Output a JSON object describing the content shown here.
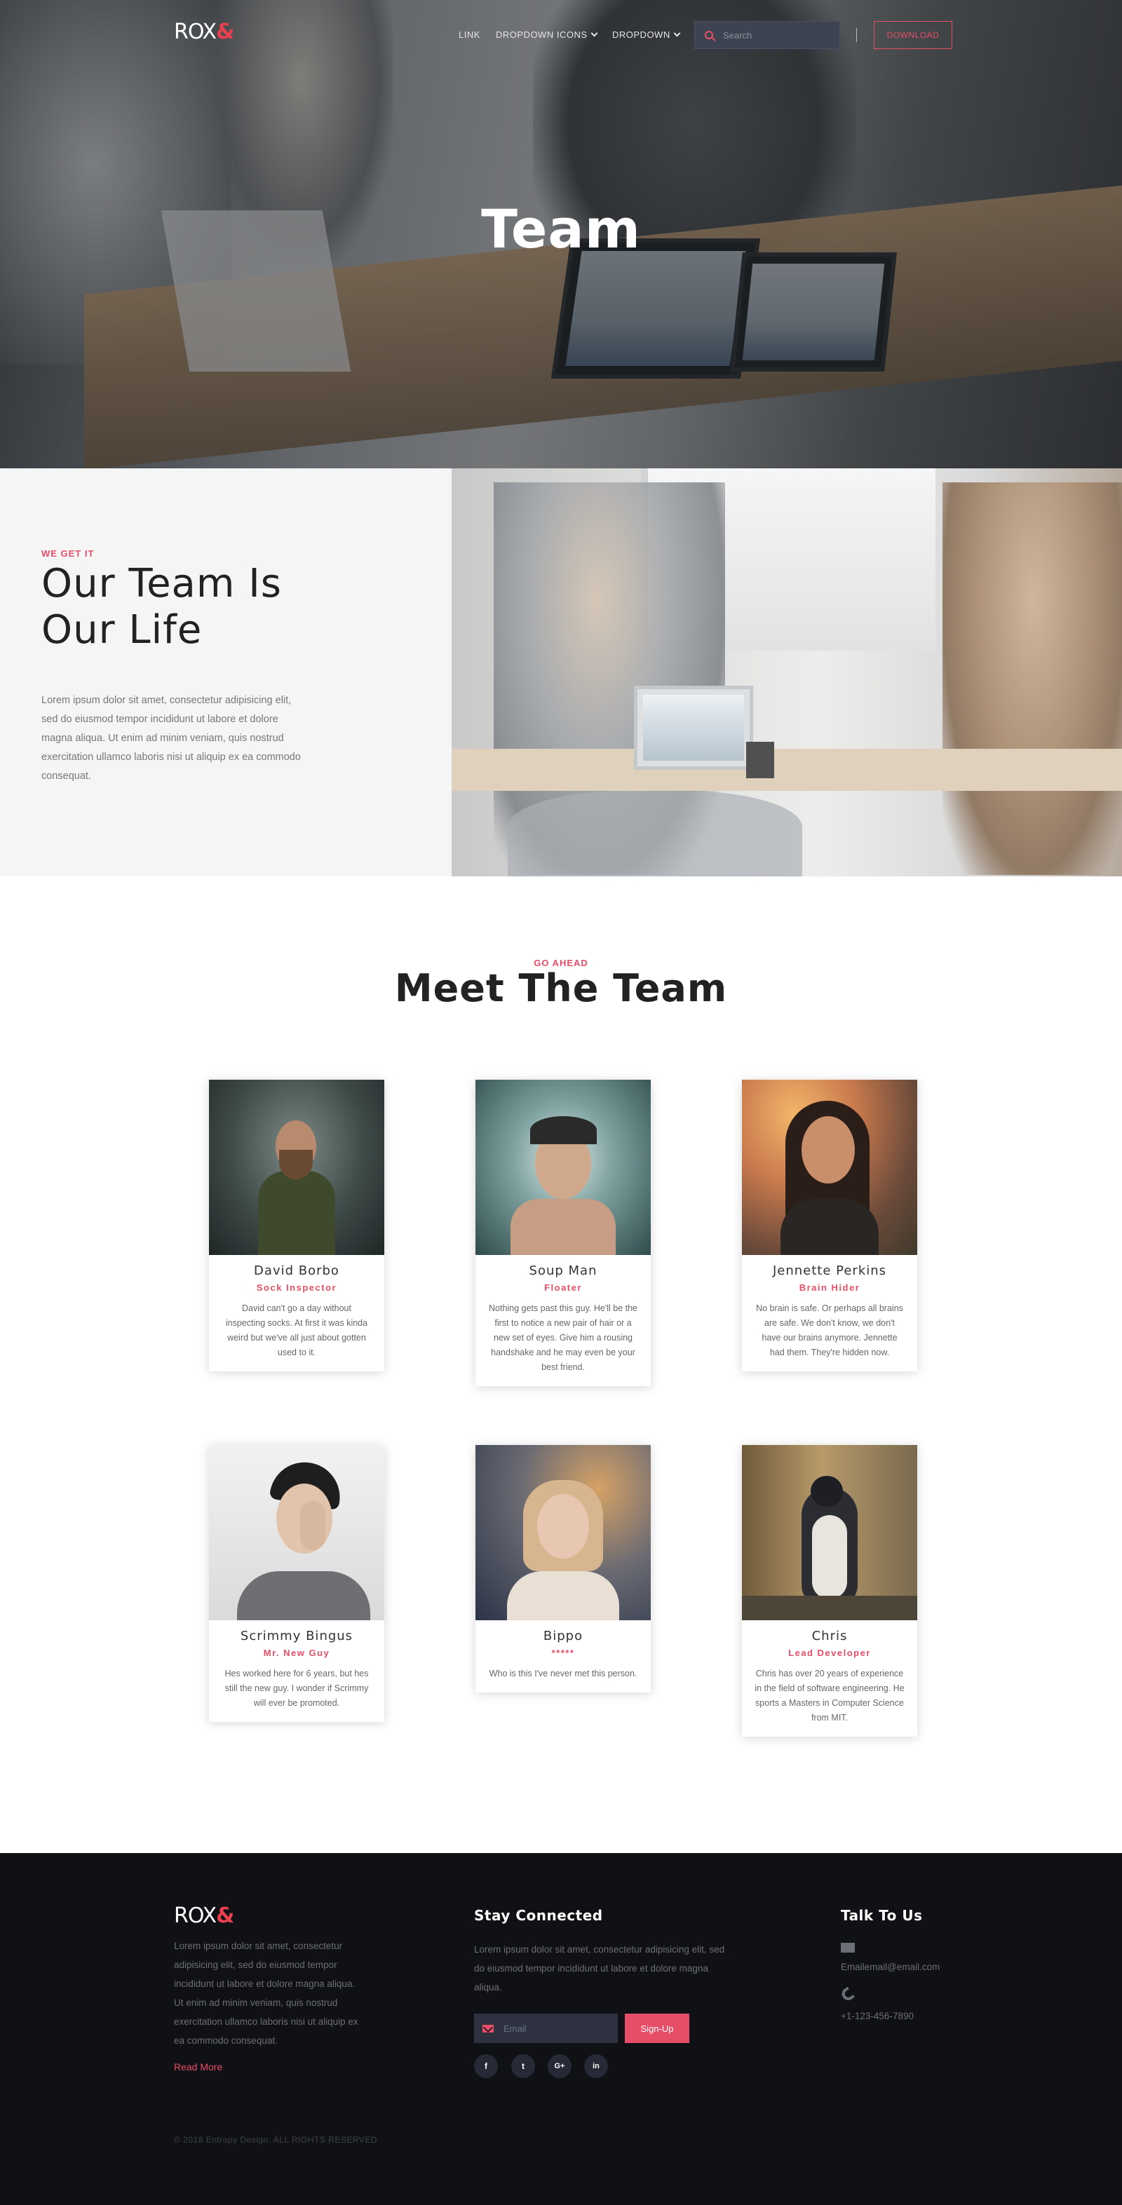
{
  "brand": {
    "logo_text": "ROX",
    "logo_amp": "&"
  },
  "nav": {
    "items": [
      {
        "label": "LINK",
        "dropdown": false
      },
      {
        "label": "DROPDOWN ICONS",
        "dropdown": true
      },
      {
        "label": "DROPDOWN",
        "dropdown": true
      }
    ],
    "search_placeholder": "Search",
    "download_label": "DOWNLOAD"
  },
  "hero": {
    "title": "Team"
  },
  "about": {
    "eyebrow": "WE GET IT",
    "heading_line1": "Our Team Is",
    "heading_line2": "Our Life",
    "body": "Lorem ipsum dolor sit amet, consectetur adipisicing elit, sed do eiusmod tempor incididunt ut labore et dolore magna aliqua. Ut enim ad minim veniam, quis nostrud exercitation ullamco laboris nisi ut aliquip ex ea commodo consequat."
  },
  "team": {
    "eyebrow": "GO AHEAD",
    "heading": "Meet The Team",
    "members": [
      {
        "name": "David Borbo",
        "role": "Sock Inspector",
        "desc": "David can't go a day without inspecting socks. At first it was kinda weird but we've all just about gotten used to it."
      },
      {
        "name": "Soup Man",
        "role": "Floater",
        "desc": "Nothing gets past this guy. He'll be the first to notice a new pair of hair or a new set of eyes. Give him a rousing handshake and he may even be your best friend."
      },
      {
        "name": "Jennette Perkins",
        "role": "Brain Hider",
        "desc": "No brain is safe. Or perhaps all brains are safe. We don't know, we don't have our brains anymore. Jennette had them. They're hidden now."
      },
      {
        "name": "Scrimmy Bingus",
        "role": "Mr. New Guy",
        "desc": "Hes worked here for 6 years, but hes still the new guy. I wonder if Scrimmy will ever be promoted."
      },
      {
        "name": "Bippo",
        "role": "*****",
        "desc": "Who is this I've never met this person."
      },
      {
        "name": "Chris",
        "role": "Lead Developer",
        "desc": "Chris has over 20 years of experience in the field of software engineering. He sports a Masters in Computer Science from MIT."
      }
    ]
  },
  "footer": {
    "about_text": "Lorem ipsum dolor sit amet, consectetur adipisicing elit, sed do eiusmod tempor incididunt ut labore et dolore magna aliqua. Ut enim ad minim veniam, quis nostrud exercitation ullamco laboris nisi ut aliquip ex ea commodo consequat.",
    "read_more": "Read More",
    "stay_heading": "Stay Connected",
    "stay_text": "Lorem ipsum dolor sit amet, consectetur adipisicing elit, sed do eiusmod tempor incididunt ut labore et dolore magna aliqua.",
    "email_placeholder": "Email",
    "signup_label": "Sign-Up",
    "social": [
      {
        "icon": "facebook-icon",
        "glyph": "f"
      },
      {
        "icon": "twitter-icon",
        "glyph": "t"
      },
      {
        "icon": "google-plus-icon",
        "glyph": "G+"
      },
      {
        "icon": "linkedin-icon",
        "glyph": "in"
      }
    ],
    "talk_heading": "Talk To Us",
    "email": "Emailemail@email.com",
    "phone": "+1-123-456-7890",
    "copyright": "© 2018 Entropy Design. ALL RIGHTS RESERVED"
  },
  "colors": {
    "accent": "#e84d68",
    "footer_bg": "#101114",
    "about_bg": "#f5f5f5"
  }
}
